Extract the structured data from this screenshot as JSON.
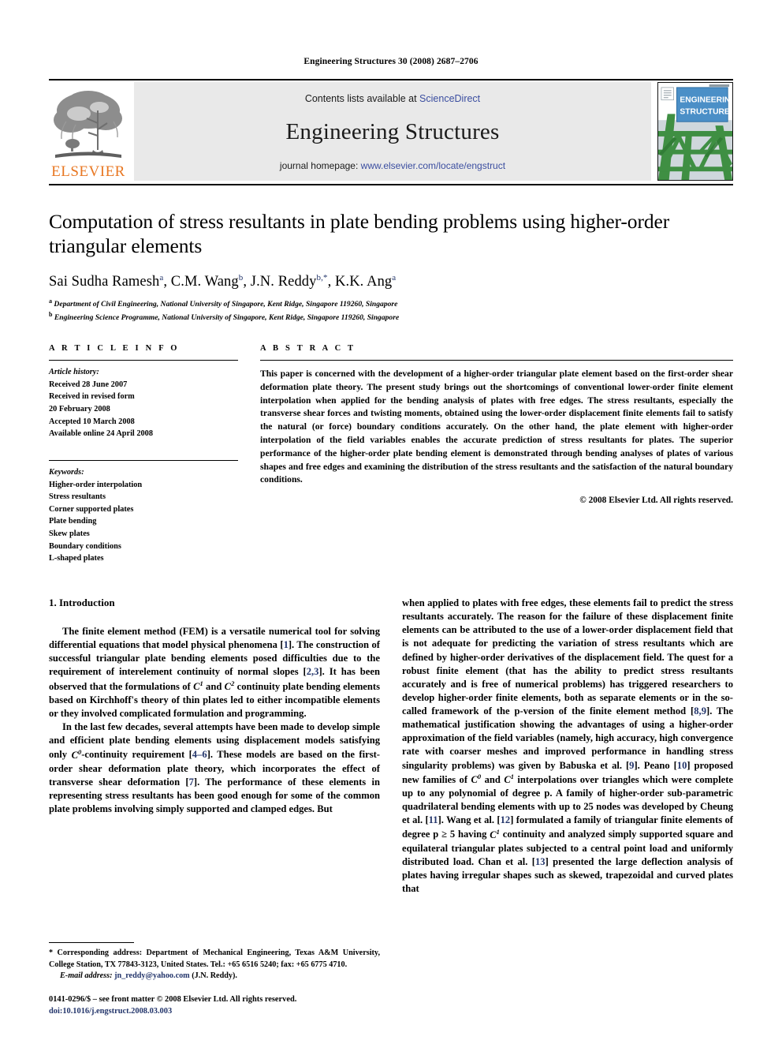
{
  "running_head": "Engineering Structures 30 (2008) 2687–2706",
  "banner": {
    "publisher_name": "ELSEVIER",
    "contents_prefix": "Contents lists available at ",
    "contents_link": "ScienceDirect",
    "journal_name": "Engineering Structures",
    "homepage_prefix": "journal homepage: ",
    "homepage_link": "www.elsevier.com/locate/engstruct",
    "cover_title_line1": "ENGINEERING",
    "cover_title_line2": "STRUCTURES",
    "link_color": "#3b4ea0",
    "elsevier_orange": "#E87722"
  },
  "article": {
    "title": "Computation of stress resultants in plate bending problems using higher-order triangular elements",
    "authors": "Sai Sudha Ramesh a, C.M. Wang b, J.N. Reddy b,*, K.K. Ang a",
    "author_list": [
      {
        "name": "Sai Sudha Ramesh",
        "sup": "a"
      },
      {
        "name": "C.M. Wang",
        "sup": "b"
      },
      {
        "name": "J.N. Reddy",
        "sup": "b,*"
      },
      {
        "name": "K.K. Ang",
        "sup": "a"
      }
    ],
    "affiliations": [
      {
        "marker": "a",
        "text": "Department of Civil Engineering, National University of Singapore, Kent Ridge, Singapore 119260, Singapore"
      },
      {
        "marker": "b",
        "text": "Engineering Science Programme, National University of Singapore, Kent Ridge, Singapore 119260, Singapore"
      }
    ]
  },
  "article_info": {
    "heading": "A R T I C L E    I N F O",
    "history_label": "Article history:",
    "history": [
      "Received 28 June 2007",
      "Received in revised form",
      "20 February 2008",
      "Accepted 10 March 2008",
      "Available online 24 April 2008"
    ],
    "keywords_label": "Keywords:",
    "keywords": [
      "Higher-order interpolation",
      "Stress resultants",
      "Corner supported plates",
      "Plate bending",
      "Skew plates",
      "Boundary conditions",
      "L-shaped plates"
    ]
  },
  "abstract": {
    "heading": "A B S T R A C T",
    "text": "This paper is concerned with the development of a higher-order triangular plate element based on the first-order shear deformation plate theory. The present study brings out the shortcomings of conventional lower-order finite element interpolation when applied for the bending analysis of plates with free edges. The stress resultants, especially the transverse shear forces and twisting moments, obtained using the lower-order displacement finite elements fail to satisfy the natural (or force) boundary conditions accurately. On the other hand, the plate element with higher-order interpolation of the field variables enables the accurate prediction of stress resultants for plates. The superior performance of the higher-order plate bending element is demonstrated through bending analyses of plates of various shapes and free edges and examining the distribution of the stress resultants and the satisfaction of the natural boundary conditions.",
    "copyright": "© 2008 Elsevier Ltd. All rights reserved."
  },
  "introduction": {
    "section_number_title": "1. Introduction",
    "left_para_1_a": "The finite element method (FEM) is a versatile numerical tool for solving differential equations that model physical phenomena [",
    "left_para_1_ref1": "1",
    "left_para_1_b": "]. The construction of successful triangular plate bending elements posed difficulties due to the requirement of interelement continuity of normal slopes [",
    "left_para_1_ref2": "2,3",
    "left_para_1_c": "]. It has been observed that the formulations of ",
    "left_para_1_d": " and ",
    "left_para_1_e": " continuity plate bending elements based on Kirchhoff's theory of thin plates led to either incompatible elements or they involved complicated formulation and programming.",
    "left_para_2_a": "In the last few decades, several attempts have been made to develop simple and efficient plate bending elements using displacement models satisfying only ",
    "left_para_2_b": "-continuity requirement [",
    "left_para_2_ref1": "4–6",
    "left_para_2_c": "]. These models are based on the first-order shear deformation plate theory, which incorporates the effect of transverse shear deformation [",
    "left_para_2_ref2": "7",
    "left_para_2_d": "]. The performance of these elements in representing stress resultants has been good enough for some of the common plate problems involving simply supported and clamped edges. But",
    "right_para_a": "when applied to plates with free edges, these elements fail to predict the stress resultants accurately. The reason for the failure of these displacement finite elements can be attributed to the use of a lower-order displacement field that is not adequate for predicting the variation of stress resultants which are defined by higher-order derivatives of the displacement field. The quest for a robust finite element (that has the ability to predict stress resultants accurately and is free of numerical problems) has triggered researchers to develop higher-order finite elements, both as separate elements or in the so-called framework of the p-version of the finite element method [",
    "right_ref_89": "8,9",
    "right_para_b": "]. The mathematical justification showing the advantages of using a higher-order approximation of the field variables (namely, high accuracy, high convergence rate with coarser meshes and improved performance in handling stress singularity problems) was given by Babuska et al. [",
    "right_ref_9": "9",
    "right_para_c": "]. Peano [",
    "right_ref_10": "10",
    "right_para_d": "] proposed new families of ",
    "right_para_e": " and ",
    "right_para_f": " interpolations over triangles which were complete up to any polynomial of degree p. A family of higher-order sub-parametric quadrilateral bending elements with up to 25 nodes was developed by Cheung et al. [",
    "right_ref_11": "11",
    "right_para_g": "]. Wang et al. [",
    "right_ref_12": "12",
    "right_para_h": "] formulated a family of triangular finite elements of degree p ≥ 5 having ",
    "right_para_i": " continuity and analyzed simply supported square and equilateral triangular plates subjected to a central point load and uniformly distributed load. Chan et al. [",
    "right_ref_13": "13",
    "right_para_j": "] presented the large deflection analysis of plates having irregular shapes such as skewed, trapezoidal and curved plates that"
  },
  "footnote": {
    "corresponding": "* Corresponding address: Department of Mechanical Engineering, Texas A&M University, College Station, TX 77843-3123, United States. Tel.: +65 6516 5240; fax: +65 6775 4710.",
    "email_label": "E-mail address:",
    "email": "jn_reddy@yahoo.com",
    "email_owner": "(J.N. Reddy).",
    "issn_line": "0141-0296/$ – see front matter © 2008 Elsevier Ltd. All rights reserved.",
    "doi_line": "doi:10.1016/j.engstruct.2008.03.003"
  }
}
